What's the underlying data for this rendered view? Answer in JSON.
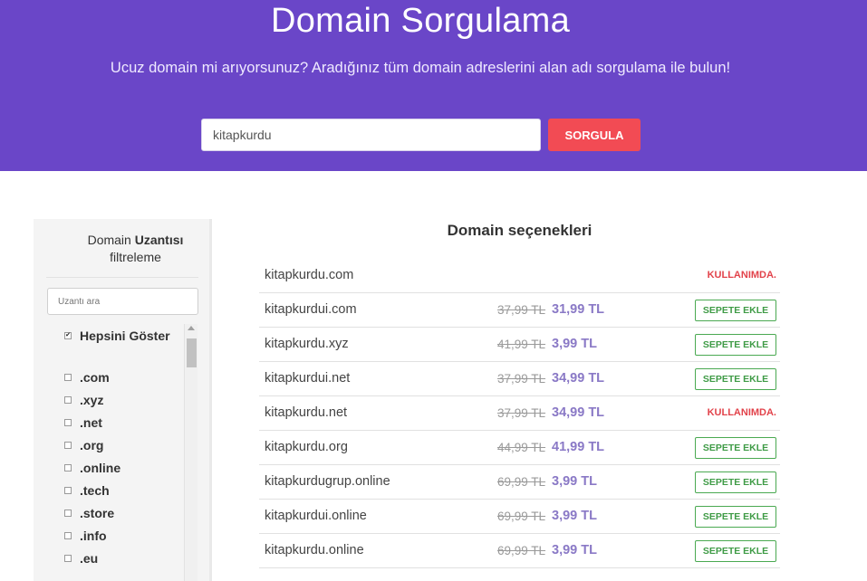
{
  "hero": {
    "title": "Domain Sorgulama",
    "subtitle": "Ucuz domain mi arıyorsunuz? Aradığınız tüm domain adreslerini alan adı sorgulama ile bulun!",
    "search_value": "kitapkurdu",
    "search_button": "SORGULA",
    "background_color": "#6a46c8",
    "button_color": "#f24b54"
  },
  "sidebar": {
    "title_prefix": "Domain",
    "title_bold": "Uzantısı",
    "title_suffix": "filtreleme",
    "search_placeholder": "Uzantı ara",
    "items": [
      {
        "label": "Hepsini Göster",
        "checked": true
      },
      {
        "label": ".com",
        "checked": false
      },
      {
        "label": ".xyz",
        "checked": false
      },
      {
        "label": ".net",
        "checked": false
      },
      {
        "label": ".org",
        "checked": false
      },
      {
        "label": ".online",
        "checked": false
      },
      {
        "label": ".tech",
        "checked": false
      },
      {
        "label": ".store",
        "checked": false
      },
      {
        "label": ".info",
        "checked": false
      },
      {
        "label": ".eu",
        "checked": false
      }
    ]
  },
  "results": {
    "title": "Domain seçenekleri",
    "used_label": "KULLANIMDA.",
    "add_label": "SEPETE EKLE",
    "rows": [
      {
        "domain": "kitapkurdu.com",
        "old_price": "",
        "new_price": "",
        "available": false
      },
      {
        "domain": "kitapkurdui.com",
        "old_price": "37,99 TL",
        "new_price": "31,99 TL",
        "available": true
      },
      {
        "domain": "kitapkurdu.xyz",
        "old_price": "41,99 TL",
        "new_price": "3,99 TL",
        "available": true
      },
      {
        "domain": "kitapkurdui.net",
        "old_price": "37,99 TL",
        "new_price": "34,99 TL",
        "available": true
      },
      {
        "domain": "kitapkurdu.net",
        "old_price": "37,99 TL",
        "new_price": "34,99 TL",
        "available": false
      },
      {
        "domain": "kitapkurdu.org",
        "old_price": "44,99 TL",
        "new_price": "41,99 TL",
        "available": true
      },
      {
        "domain": "kitapkurdugrup.online",
        "old_price": "69,99 TL",
        "new_price": "3,99 TL",
        "available": true
      },
      {
        "domain": "kitapkurdui.online",
        "old_price": "69,99 TL",
        "new_price": "3,99 TL",
        "available": true
      },
      {
        "domain": "kitapkurdu.online",
        "old_price": "69,99 TL",
        "new_price": "3,99 TL",
        "available": true
      }
    ]
  }
}
